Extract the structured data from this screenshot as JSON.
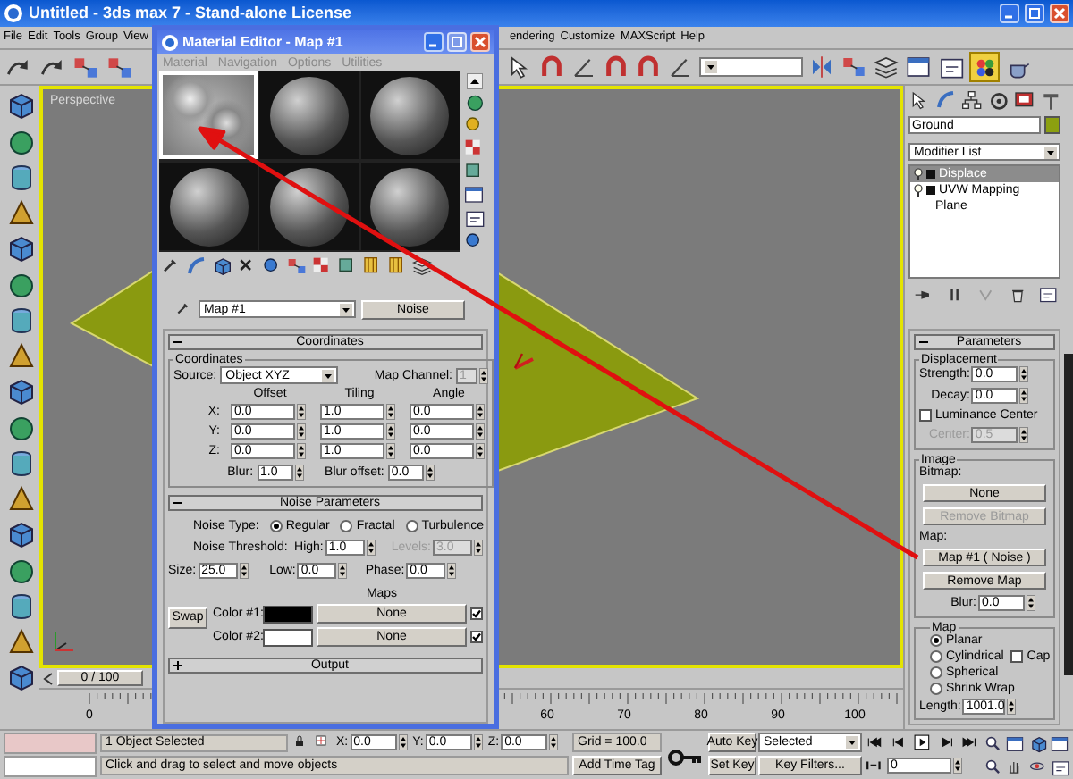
{
  "window": {
    "title": "Untitled - 3ds max 7  - Stand-alone License"
  },
  "menu": [
    "File",
    "Edit",
    "Tools",
    "Group",
    "View",
    "endering",
    "Customize",
    "MAXScript",
    "Help"
  ],
  "viewport": {
    "label": "Perspective"
  },
  "time_slider": {
    "position": "0 / 100"
  },
  "ruler": {
    "labels": [
      "0",
      "60",
      "70",
      "80",
      "90",
      "100"
    ]
  },
  "material_editor": {
    "title": "Material Editor - Map #1",
    "menu": [
      "Material",
      "Navigation",
      "Options",
      "Utilities"
    ],
    "slots": [
      {
        "kind": "noise",
        "selected": true
      },
      {
        "kind": "sphere",
        "selected": false
      },
      {
        "kind": "sphere",
        "selected": false
      },
      {
        "kind": "sphere",
        "selected": false
      },
      {
        "kind": "sphere",
        "selected": false
      },
      {
        "kind": "sphere",
        "selected": false
      }
    ],
    "map_name": "Map #1",
    "map_type": "Noise",
    "coordinates": {
      "header": "Coordinates",
      "expanded": true,
      "group": "Coordinates",
      "source_label": "Source:",
      "source": "Object XYZ",
      "channel": {
        "label": "Map Channel:",
        "value": "1",
        "disabled": true
      },
      "columns": [
        "Offset",
        "Tiling",
        "Angle"
      ],
      "rows": [
        {
          "axis": "X:",
          "values": [
            "0.0",
            "1.0",
            "0.0"
          ]
        },
        {
          "axis": "Y:",
          "values": [
            "0.0",
            "1.0",
            "0.0"
          ]
        },
        {
          "axis": "Z:",
          "values": [
            "0.0",
            "1.0",
            "0.0"
          ]
        }
      ],
      "blur": {
        "label": "Blur:",
        "value": "1.0"
      },
      "blur_offset": {
        "label": "Blur offset:",
        "value": "0.0"
      }
    },
    "noise": {
      "header": "Noise Parameters",
      "expanded": true,
      "type_label": "Noise Type:",
      "types": [
        {
          "label": "Regular",
          "selected": true
        },
        {
          "label": "Fractal",
          "selected": false
        },
        {
          "label": "Turbulence",
          "selected": false
        }
      ],
      "threshold_label": "Noise Threshold:",
      "high": {
        "label": "High:",
        "value": "1.0"
      },
      "levels": {
        "label": "Levels:",
        "value": "3.0",
        "disabled": true
      },
      "size": {
        "label": "Size:",
        "value": "25.0"
      },
      "low": {
        "label": "Low:",
        "value": "0.0"
      },
      "phase": {
        "label": "Phase:",
        "value": "0.0"
      },
      "maps_label": "Maps",
      "swap": "Swap",
      "colors": [
        {
          "label": "Color #1:",
          "color": "#000000",
          "map": "None",
          "checked": true
        },
        {
          "label": "Color #2:",
          "color": "#ffffff",
          "map": "None",
          "checked": true
        }
      ]
    },
    "output": {
      "header": "Output",
      "expanded": false
    }
  },
  "command_panel": {
    "object_name": "Ground",
    "modifier_list": "Modifier List",
    "stack": [
      {
        "label": "Displace",
        "kind": "modifier",
        "selected": true
      },
      {
        "label": "UVW Mapping",
        "kind": "modifier",
        "selected": false
      },
      {
        "label": "Plane",
        "kind": "base",
        "selected": false
      }
    ],
    "parameters": {
      "header": "Parameters",
      "expanded": true,
      "displacement": {
        "title": "Displacement",
        "strength": {
          "label": "Strength:",
          "value": "0.0"
        },
        "decay": {
          "label": "Decay:",
          "value": "0.0"
        },
        "luminance": {
          "label": "Luminance Center",
          "checked": false
        },
        "center": {
          "label": "Center:",
          "value": "0.5",
          "disabled": true
        }
      },
      "image": {
        "title": "Image",
        "bitmap_label": "Bitmap:",
        "bitmap_button": {
          "label": "None",
          "disabled": false
        },
        "remove_bitmap": {
          "label": "Remove Bitmap",
          "disabled": true
        },
        "map_label": "Map:",
        "map_button": {
          "label": "Map #1  ( Noise )",
          "disabled": false
        },
        "remove_map": {
          "label": "Remove Map",
          "disabled": false
        },
        "blur": {
          "label": "Blur:",
          "value": "0.0"
        }
      },
      "map": {
        "title": "Map",
        "options": [
          {
            "label": "Planar",
            "selected": true
          },
          {
            "label": "Cylindrical",
            "selected": false
          },
          {
            "label": "Spherical",
            "selected": false
          },
          {
            "label": "Shrink Wrap",
            "selected": false
          }
        ],
        "cap": {
          "label": "Cap",
          "checked": false
        },
        "length": {
          "label": "Length:",
          "value": "1001.0"
        }
      }
    }
  },
  "status": {
    "selection": "1 Object Selected",
    "prompt": "Click and drag to select and move objects",
    "coords": [
      {
        "label": "X:",
        "value": "0.0"
      },
      {
        "label": "Y:",
        "value": "0.0"
      },
      {
        "label": "Z:",
        "value": "0.0"
      }
    ],
    "grid": "Grid = 100.0",
    "add_time_tag": "Add Time Tag",
    "auto_key": "Auto Key",
    "key_mode": "Selected",
    "set_key": "Set Key",
    "key_filters": "Key Filters...",
    "frame": "0"
  }
}
